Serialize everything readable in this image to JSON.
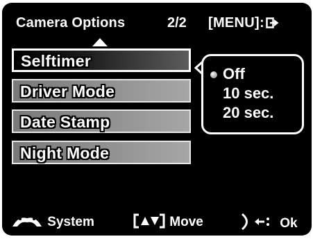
{
  "header": {
    "title": "Camera Options",
    "page": "2/2",
    "menu_hint": "[MENU]:"
  },
  "menu": {
    "items": [
      {
        "label": "Selftimer",
        "selected": true
      },
      {
        "label": "Driver Mode",
        "selected": false
      },
      {
        "label": "Date Stamp",
        "selected": false
      },
      {
        "label": "Night Mode",
        "selected": false
      }
    ]
  },
  "options": {
    "items": [
      {
        "label": "Off",
        "selected": true
      },
      {
        "label": "10 sec.",
        "selected": false
      },
      {
        "label": "20 sec.",
        "selected": false
      }
    ]
  },
  "footer": {
    "system_label": "System",
    "move_label": "Move",
    "ok_label": "Ok"
  },
  "colors": {
    "background": "#000000",
    "text": "#ffffff",
    "item_gray": "#8d8d8d"
  },
  "icons": {
    "exit": "exit-arrow-icon",
    "system": "mountain-arch-icon",
    "move": "up-down-bracket-icon",
    "ok": "enter-arrow-icon"
  }
}
